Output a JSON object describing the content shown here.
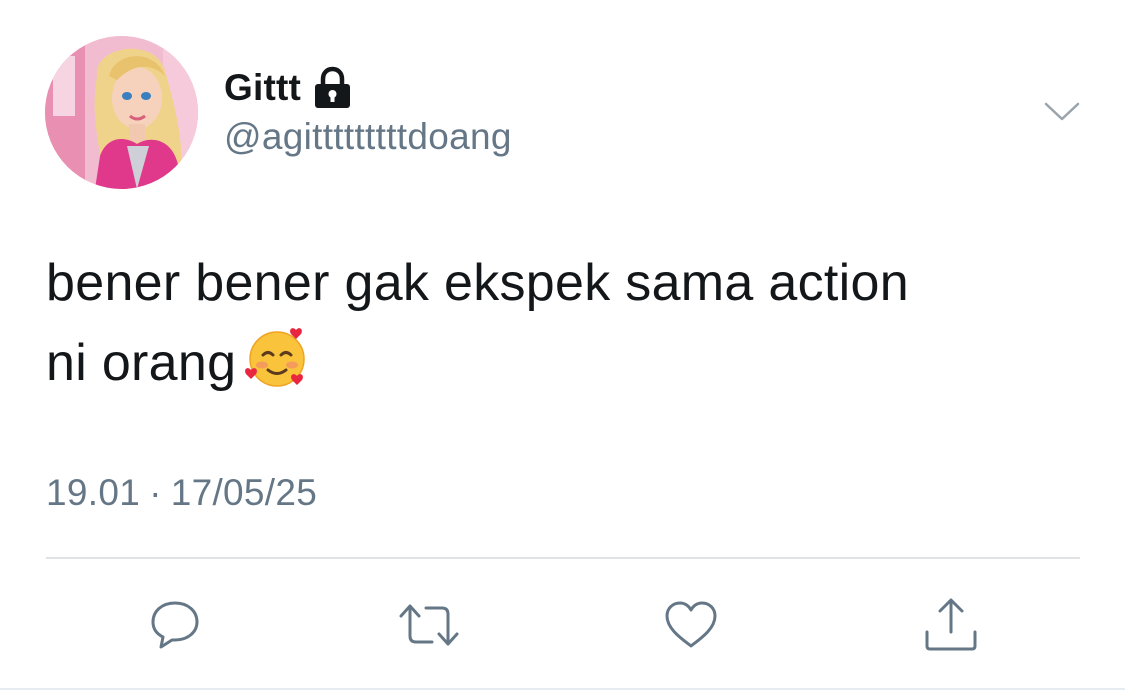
{
  "user": {
    "display_name": "Gittt",
    "handle": "@agitttttttttdoang",
    "protected": true
  },
  "tweet": {
    "text_line1": "bener bener gak ekspek sama action",
    "text_line2": "ni orang",
    "emoji": "smiling-face-with-hearts",
    "time": "19.01",
    "separator": "·",
    "date": "17/05/25"
  },
  "icons": {
    "lock": "lock-icon",
    "menu": "chevron-down-icon",
    "reply": "reply-icon",
    "retweet": "retweet-icon",
    "like": "heart-icon",
    "share": "share-icon"
  },
  "colors": {
    "text": "#14171a",
    "secondary": "#657786",
    "icon": "#657786",
    "divider": "#dfe3e6",
    "background": "#ffffff"
  }
}
